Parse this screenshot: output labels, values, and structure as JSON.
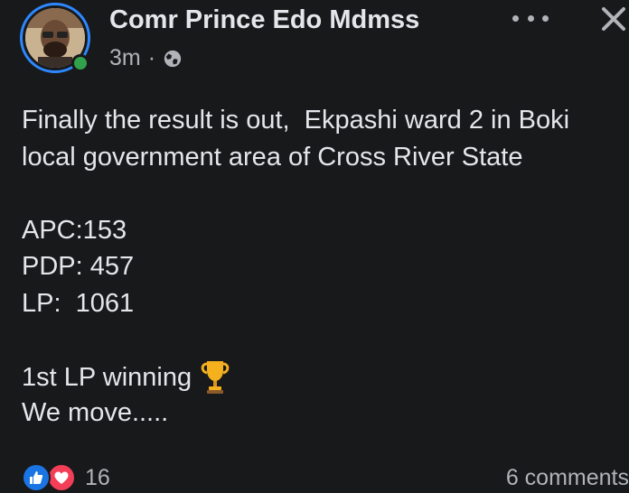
{
  "post": {
    "author": "Comr Prince Edo Mdmss",
    "time": "3m",
    "separator": "·",
    "privacy_icon": "globe-icon",
    "menu_icon": "more-horizontal-icon",
    "close_icon": "close-icon",
    "body_lines": [
      "Finally the result is out,  Ekpashi ward 2 in Boki",
      "local government area of Cross River State",
      "",
      "APC:153",
      "PDP: 457",
      "LP:  1061",
      "",
      "1st LP winning",
      "We move....."
    ],
    "emoji": "trophy-emoji"
  },
  "footer": {
    "reaction_icons": [
      "like-icon",
      "love-icon"
    ],
    "reaction_count": "16",
    "comments": "6 comments"
  },
  "colors": {
    "background": "#18191a",
    "text": "#e4e6eb",
    "secondary_text": "#b0b3b8",
    "ring": "#2d88ff",
    "online": "#31a24c",
    "like": "#1b74e4",
    "love": "#f33e58"
  }
}
